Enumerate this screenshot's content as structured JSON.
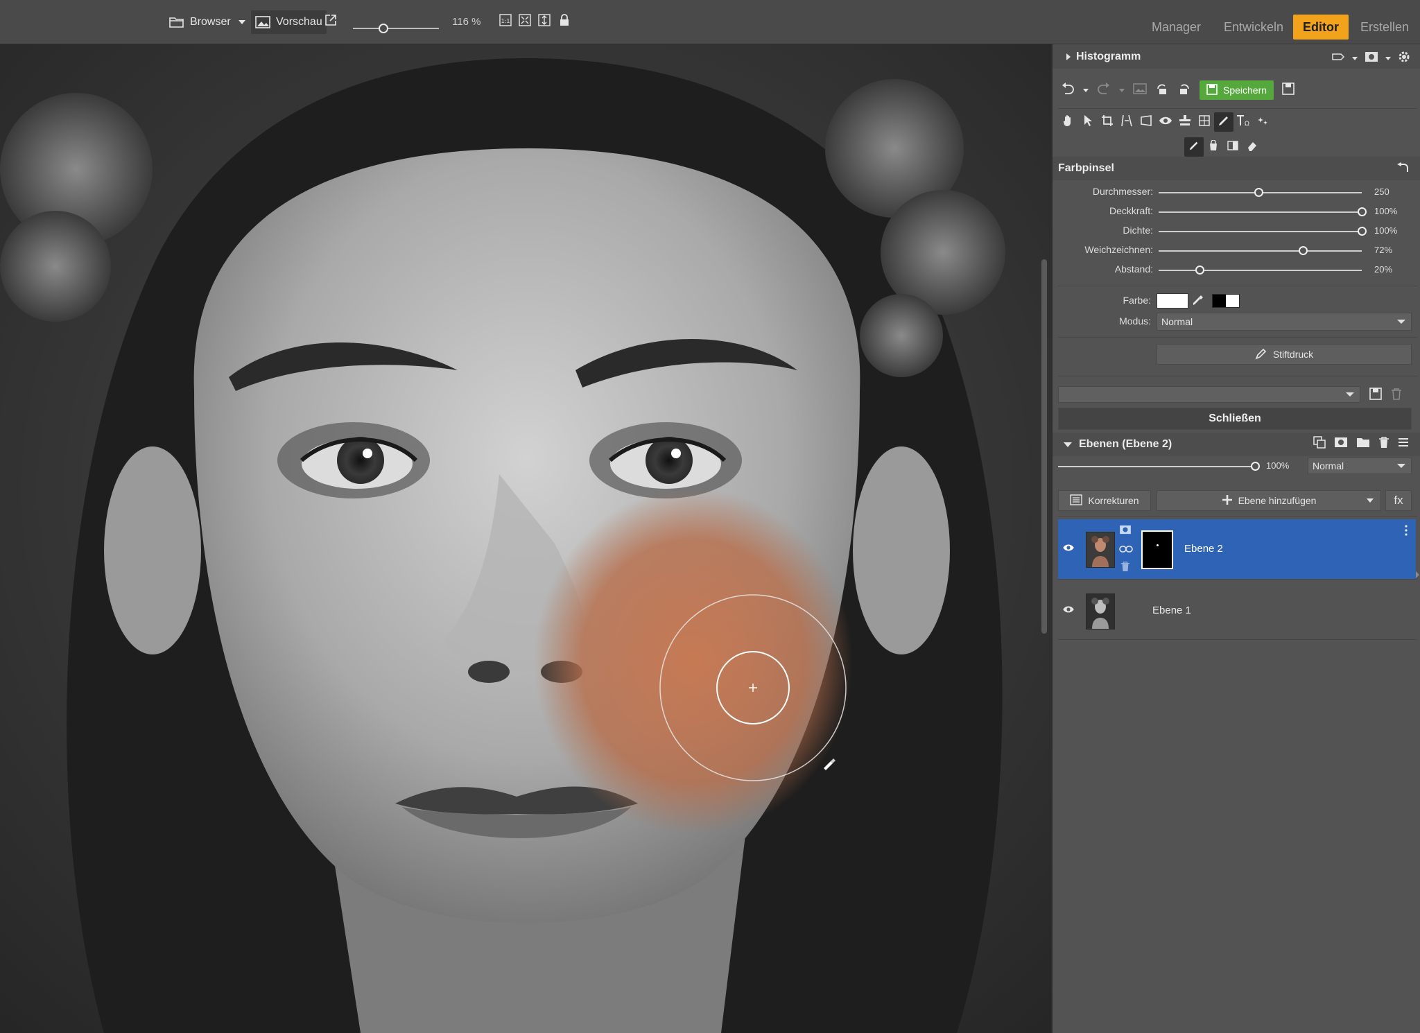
{
  "topbar": {
    "browser_label": "Browser",
    "preview_label": "Vorschau",
    "zoom_level": "116 %",
    "zoom_fraction": 0.35,
    "modes": [
      {
        "label": "Manager",
        "active": false
      },
      {
        "label": "Entwickeln",
        "active": false
      },
      {
        "label": "Editor",
        "active": true
      },
      {
        "label": "Erstellen",
        "active": false
      }
    ]
  },
  "panel": {
    "histogram_title": "Histogramm",
    "save_label": "Speichern",
    "brush_title": "Farbpinsel",
    "sliders": [
      {
        "label": "Durchmesser:",
        "value": "250",
        "fraction": 0.49
      },
      {
        "label": "Deckkraft:",
        "value": "100%",
        "fraction": 1.0
      },
      {
        "label": "Dichte:",
        "value": "100%",
        "fraction": 1.0
      },
      {
        "label": "Weichzeichnen:",
        "value": "72%",
        "fraction": 0.71
      },
      {
        "label": "Abstand:",
        "value": "20%",
        "fraction": 0.2
      }
    ],
    "color_label": "Farbe:",
    "mode_label": "Modus:",
    "mode_value": "Normal",
    "pen_pressure_label": "Stiftdruck",
    "preset_value": "",
    "close_label": "Schließen",
    "layers_title": "Ebenen (Ebene 2)",
    "layer_opacity": "100%",
    "layer_opacity_fraction": 1.0,
    "layer_blend_mode": "Normal",
    "corrections_label": "Korrekturen",
    "add_layer_label": "Ebene hinzufügen",
    "fx_label": "fx",
    "layers": [
      {
        "name": "Ebene 2",
        "selected": true
      },
      {
        "name": "Ebene 1",
        "selected": false
      }
    ]
  },
  "colors": {
    "accent": "#f2a21b",
    "save_green": "#54a83c",
    "selection_blue": "#2e63b5",
    "brush_paint": "#c8774f"
  }
}
